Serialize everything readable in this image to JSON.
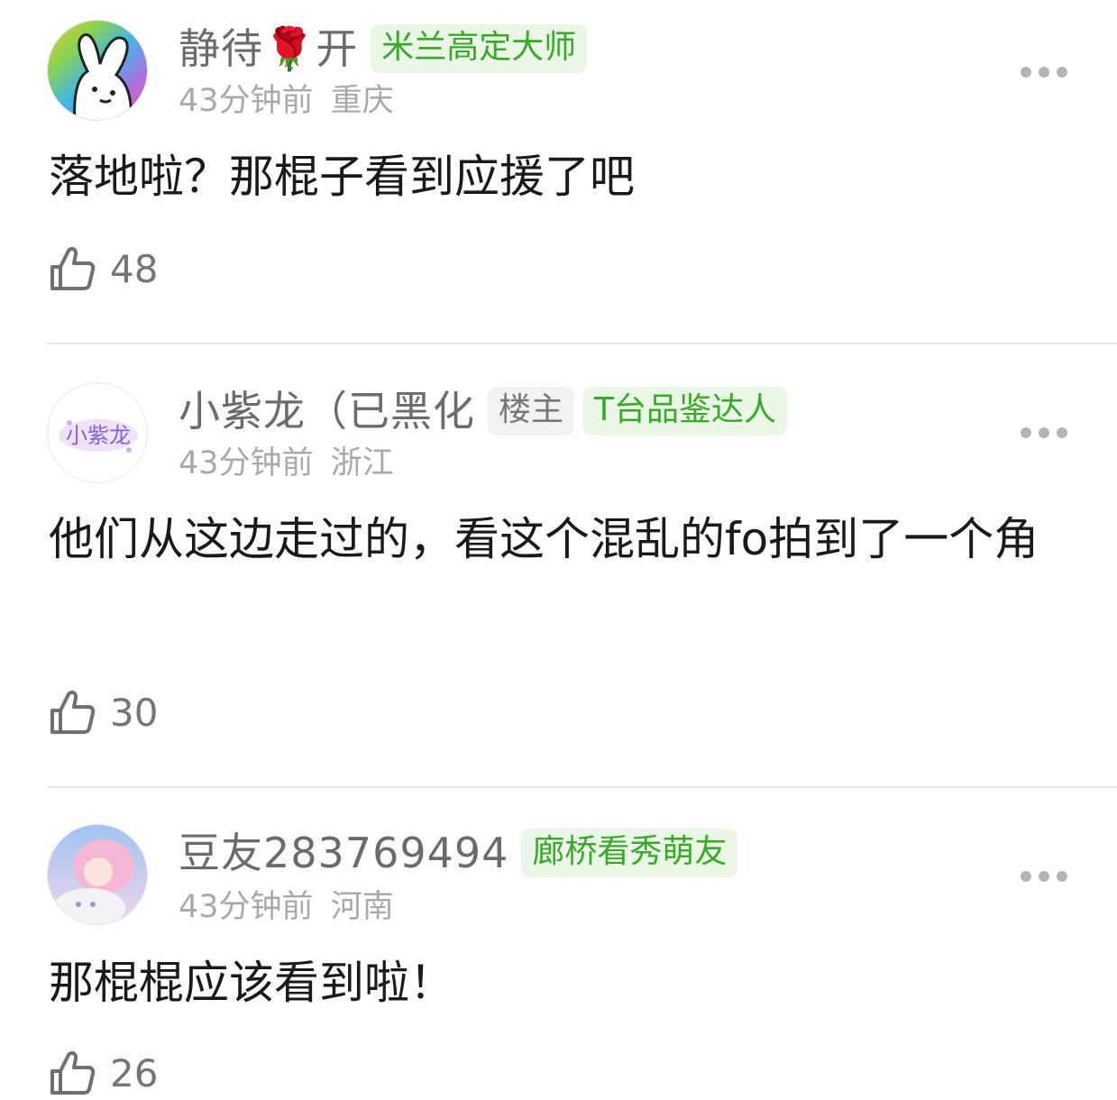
{
  "comments": [
    {
      "username": "静待🌹开",
      "badges": [
        {
          "text": "米兰高定大师",
          "style": "green"
        }
      ],
      "time": "43分钟前",
      "location": "重庆",
      "content": "落地啦？那棍子看到应援了吧",
      "likes": "48",
      "avatar": "rabbit-avatar"
    },
    {
      "username": "小紫龙（已黑化",
      "badges": [
        {
          "text": "楼主",
          "style": "grey"
        },
        {
          "text": "T台品鉴达人",
          "style": "green"
        }
      ],
      "time": "43分钟前",
      "location": "浙江",
      "content": "他们从这边走过的，看这个混乱的fo拍到了一个角",
      "likes": "30",
      "avatar": "purple-text-avatar",
      "avatar_text": "小紫龙"
    },
    {
      "username": "豆友283769494",
      "badges": [
        {
          "text": "廊桥看秀萌友",
          "style": "green"
        }
      ],
      "time": "43分钟前",
      "location": "河南",
      "content": "那棍棍应该看到啦！",
      "likes": "26",
      "avatar": "anime-girl-avatar"
    }
  ],
  "colors": {
    "badge_green_text": "#3aa92a",
    "badge_green_bg": "#eaf6e6",
    "meta_text": "#a9a9a9",
    "username_text": "#6b6b6b"
  },
  "icons": [
    "thumbs-up-icon",
    "more-options-icon"
  ]
}
